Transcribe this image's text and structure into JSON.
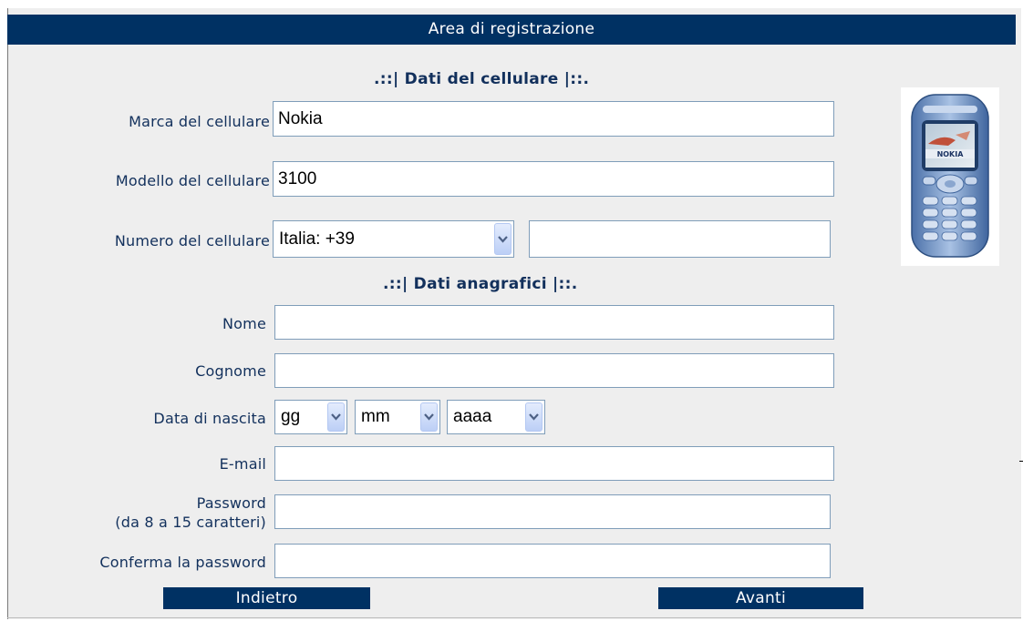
{
  "header": {
    "title": "Area di registrazione"
  },
  "sections": {
    "phone_data": ".::| Dati del cellulare |::.",
    "personal_data": ".::| Dati anagrafici |::."
  },
  "phone": {
    "brand": {
      "label": "Marca del cellulare",
      "value": "Nokia"
    },
    "model": {
      "label": "Modello del cellulare",
      "value": "3100"
    },
    "number": {
      "label": "Numero del cellulare",
      "country_selected": "Italia: +39",
      "value": ""
    },
    "image": {
      "brand_text": "NOKIA"
    }
  },
  "personal": {
    "first_name": {
      "label": "Nome",
      "value": ""
    },
    "last_name": {
      "label": "Cognome",
      "value": ""
    },
    "birth_date": {
      "label": "Data di nascita",
      "day": "gg",
      "month": "mm",
      "year": "aaaa"
    },
    "email": {
      "label": "E-mail",
      "value": ""
    },
    "password": {
      "label_line1": "Password",
      "label_line2": "(da 8 a 15 caratteri)",
      "value": ""
    },
    "confirm_password": {
      "label": "Conferma la password",
      "value": ""
    }
  },
  "buttons": {
    "back": "Indietro",
    "next": "Avanti"
  },
  "colors": {
    "accent": "#003163",
    "label_text": "#12305c",
    "panel_bg": "#eeeeee",
    "field_border": "#7f9db9"
  }
}
